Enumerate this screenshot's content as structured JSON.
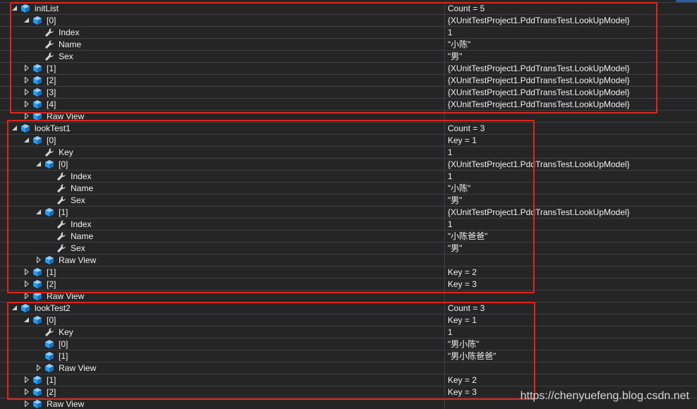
{
  "colors": {
    "background": "#252526",
    "text": "#f1f1f1",
    "grid_line": "#3f3f46",
    "annotation_box": "#e0251b"
  },
  "watch": {
    "rows": [
      {
        "name": "initList",
        "value": "Count = 5",
        "icon": "cube-icon",
        "expanded": true,
        "children": [
          {
            "name": "[0]",
            "value": "{XUnitTestProject1.PddTransTest.LookUpModel}",
            "icon": "cube-icon",
            "expanded": true,
            "children": [
              {
                "name": "Index",
                "value": "1",
                "icon": "wrench-icon"
              },
              {
                "name": "Name",
                "value": "\"小陈\"",
                "icon": "wrench-icon"
              },
              {
                "name": "Sex",
                "value": "\"男\"",
                "icon": "wrench-icon"
              }
            ]
          },
          {
            "name": "[1]",
            "value": "{XUnitTestProject1.PddTransTest.LookUpModel}",
            "icon": "cube-icon",
            "expanded": false
          },
          {
            "name": "[2]",
            "value": "{XUnitTestProject1.PddTransTest.LookUpModel}",
            "icon": "cube-icon",
            "expanded": false
          },
          {
            "name": "[3]",
            "value": "{XUnitTestProject1.PddTransTest.LookUpModel}",
            "icon": "cube-icon",
            "expanded": false
          },
          {
            "name": "[4]",
            "value": "{XUnitTestProject1.PddTransTest.LookUpModel}",
            "icon": "cube-icon",
            "expanded": false
          },
          {
            "name": "Raw View",
            "icon": "cube-icon",
            "expanded": false
          }
        ]
      },
      {
        "name": "lookTest1",
        "value": "Count = 3",
        "icon": "cube-icon",
        "expanded": true,
        "children": [
          {
            "name": "[0]",
            "value": "Key = 1",
            "icon": "cube-icon",
            "expanded": true,
            "children": [
              {
                "name": "Key",
                "value": "1",
                "icon": "wrench-icon"
              },
              {
                "name": "[0]",
                "value": "{XUnitTestProject1.PddTransTest.LookUpModel}",
                "icon": "cube-icon",
                "expanded": true,
                "children": [
                  {
                    "name": "Index",
                    "value": "1",
                    "icon": "wrench-icon"
                  },
                  {
                    "name": "Name",
                    "value": "\"小陈\"",
                    "icon": "wrench-icon"
                  },
                  {
                    "name": "Sex",
                    "value": "\"男\"",
                    "icon": "wrench-icon"
                  }
                ]
              },
              {
                "name": "[1]",
                "value": "{XUnitTestProject1.PddTransTest.LookUpModel}",
                "icon": "cube-icon",
                "expanded": true,
                "children": [
                  {
                    "name": "Index",
                    "value": "1",
                    "icon": "wrench-icon"
                  },
                  {
                    "name": "Name",
                    "value": "\"小陈爸爸\"",
                    "icon": "wrench-icon"
                  },
                  {
                    "name": "Sex",
                    "value": "\"男\"",
                    "icon": "wrench-icon"
                  }
                ]
              },
              {
                "name": "Raw View",
                "icon": "cube-icon",
                "expanded": false
              }
            ]
          },
          {
            "name": "[1]",
            "value": "Key = 2",
            "icon": "cube-icon",
            "expanded": false
          },
          {
            "name": "[2]",
            "value": "Key = 3",
            "icon": "cube-icon",
            "expanded": false
          },
          {
            "name": "Raw View",
            "icon": "cube-icon",
            "expanded": false
          }
        ]
      },
      {
        "name": "lookTest2",
        "value": "Count = 3",
        "icon": "cube-icon",
        "expanded": true,
        "children": [
          {
            "name": "[0]",
            "value": "Key = 1",
            "icon": "cube-icon",
            "expanded": true,
            "children": [
              {
                "name": "Key",
                "value": "1",
                "icon": "wrench-icon"
              },
              {
                "name": "[0]",
                "value": "\"男小陈\"",
                "icon": "cube-icon"
              },
              {
                "name": "[1]",
                "value": "\"男小陈爸爸\"",
                "icon": "cube-icon"
              },
              {
                "name": "Raw View",
                "icon": "cube-icon",
                "expanded": false
              }
            ]
          },
          {
            "name": "[1]",
            "value": "Key = 2",
            "icon": "cube-icon",
            "expanded": false
          },
          {
            "name": "[2]",
            "value": "Key = 3",
            "icon": "cube-icon",
            "expanded": false
          },
          {
            "name": "Raw View",
            "icon": "cube-icon",
            "expanded": false
          }
        ]
      }
    ]
  },
  "watermark": "https://chenyuefeng.blog.csdn.net"
}
